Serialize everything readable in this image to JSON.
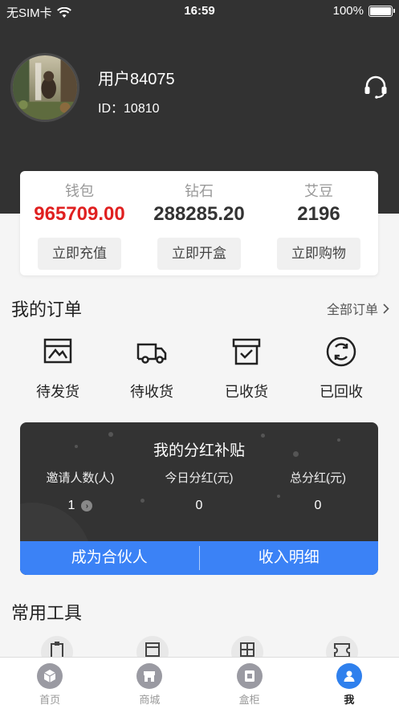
{
  "status_bar": {
    "carrier": "无SIM卡",
    "time": "16:59",
    "battery": "100%"
  },
  "profile": {
    "username": "用户84075",
    "id_label": "ID：",
    "id_value": "10810"
  },
  "wallet": [
    {
      "label": "钱包",
      "value": "965709.00",
      "button": "立即充值",
      "value_color": "#e02020"
    },
    {
      "label": "钻石",
      "value": "288285.20",
      "button": "立即开盒"
    },
    {
      "label": "艾豆",
      "value": "2196",
      "button": "立即购物"
    }
  ],
  "orders": {
    "title": "我的订单",
    "all_label": "全部订单",
    "items": [
      {
        "label": "待发货",
        "icon": "picture-box-icon"
      },
      {
        "label": "待收货",
        "icon": "truck-icon"
      },
      {
        "label": "已收货",
        "icon": "archive-box-icon"
      },
      {
        "label": "已回收",
        "icon": "recycle-icon"
      }
    ]
  },
  "dividend": {
    "title": "我的分红补贴",
    "columns": [
      {
        "label": "邀请人数(人)",
        "value": "1"
      },
      {
        "label": "今日分红(元)",
        "value": "0"
      },
      {
        "label": "总分红(元)",
        "value": "0"
      }
    ],
    "buttons": {
      "partner": "成为合伙人",
      "income": "收入明细"
    }
  },
  "tools": {
    "title": "常用工具"
  },
  "tab_bar": [
    {
      "label": "首页",
      "icon": "cube-icon"
    },
    {
      "label": "商城",
      "icon": "store-icon"
    },
    {
      "label": "盒柜",
      "icon": "box-cabinet-icon"
    },
    {
      "label": "我",
      "icon": "user-icon",
      "active": true
    }
  ],
  "colors": {
    "header": "#323232",
    "accent": "#3b82f6",
    "wallet_red": "#e02020",
    "tab_active": "#2f80ed"
  }
}
